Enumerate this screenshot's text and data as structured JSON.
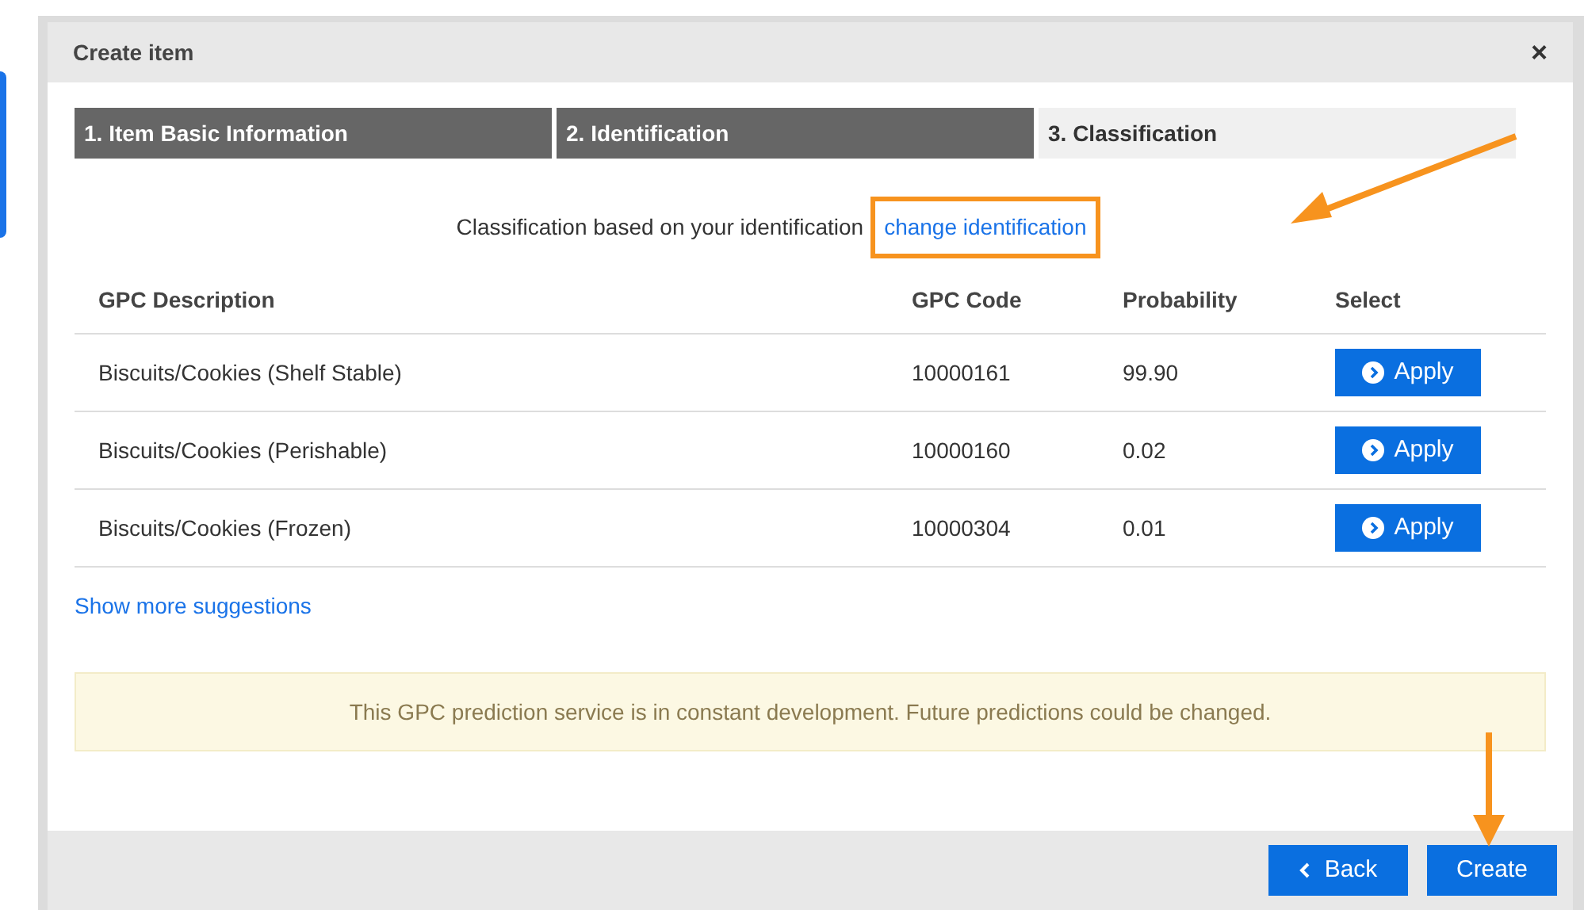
{
  "dialog": {
    "title": "Create item",
    "close": "×"
  },
  "steps": [
    {
      "label": "1. Item Basic Information",
      "selected": false
    },
    {
      "label": "2. Identification",
      "selected": false
    },
    {
      "label": "3. Classification",
      "selected": true
    }
  ],
  "intro": {
    "text": "Classification based on your identification",
    "link": "change identification",
    "highlighted": true
  },
  "table": {
    "columns": [
      "GPC Description",
      "GPC Code",
      "Probability",
      "Select"
    ],
    "rows": [
      {
        "description": "Biscuits/Cookies (Shelf Stable)",
        "code": "10000161",
        "probability": "99.90",
        "action": "Apply"
      },
      {
        "description": "Biscuits/Cookies (Perishable)",
        "code": "10000160",
        "probability": "0.02",
        "action": "Apply"
      },
      {
        "description": "Biscuits/Cookies (Frozen)",
        "code": "10000304",
        "probability": "0.01",
        "action": "Apply"
      }
    ]
  },
  "more_link": "Show more suggestions",
  "notice": "This GPC prediction service is in constant development. Future predictions could be changed.",
  "footer": {
    "buttons": [
      {
        "label": "Back",
        "kind": "back"
      },
      {
        "label": "Create",
        "kind": "primary"
      }
    ]
  }
}
